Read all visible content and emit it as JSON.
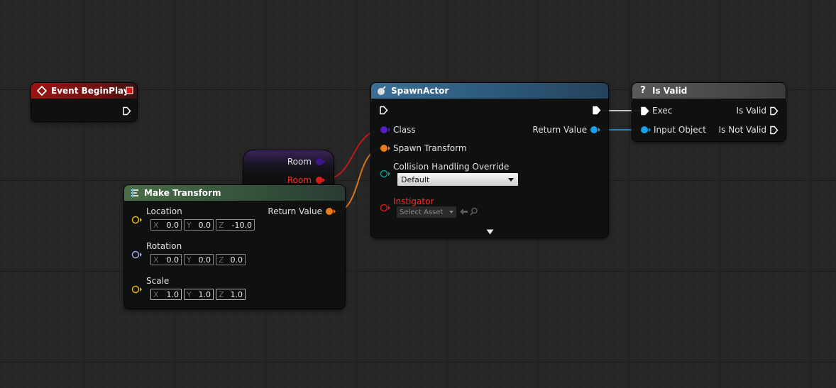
{
  "colors": {
    "exec": "#ffffff",
    "class_pin": "#5a1ac8",
    "transform_pin": "#f07a14",
    "object_pin": "#1aa0e8",
    "enum_pin": "#0a7a6e",
    "instigator_pin": "#d41a1a",
    "room_pin": "#e01a1a",
    "vector_pin": "#e8b400",
    "rotator_pin": "#9aa8e8",
    "instigator_text": "#ff2a2a",
    "room_text": "#ff2a2a",
    "event_header": "#8a1313",
    "spawn_header": "#2e5e7e",
    "make_header": "#3b5d3a",
    "isvalid_header": "#4a4a4a",
    "room_header": "#4a2a70"
  },
  "nodes": {
    "event_begin_play": {
      "title": "Event BeginPlay",
      "header_icon": "event-diamond-icon",
      "corner_icon": "delegate-square-icon"
    },
    "spawn_actor": {
      "title": "SpawnActor",
      "header_icon": "spawn-actor-icon",
      "pins": {
        "class": "Class",
        "spawn_transform": "Spawn Transform",
        "collision": "Collision Handling Override",
        "return_value": "Return Value",
        "instigator": "Instigator"
      },
      "collision_value": "Default",
      "instigator_placeholder": "Select Asset",
      "expand_icon": "chevron-down-icon"
    },
    "is_valid": {
      "title": "Is Valid",
      "header_icon": "question-mark-icon",
      "pins": {
        "exec": "Exec",
        "input_object": "Input Object",
        "is_valid": "Is Valid",
        "is_not_valid": "Is Not Valid"
      }
    },
    "room_getter": {
      "input_label": "Room",
      "output_label": "Room"
    },
    "make_transform": {
      "title": "Make Transform",
      "header_icon": "function-icon",
      "return_value": "Return Value",
      "location": {
        "label": "Location",
        "x": "0.0",
        "y": "0.0",
        "z": "-10.0"
      },
      "rotation": {
        "label": "Rotation",
        "x": "0.0",
        "y": "0.0",
        "z": "0.0"
      },
      "scale": {
        "label": "Scale",
        "x": "1.0",
        "y": "1.0",
        "z": "1.0"
      }
    }
  },
  "axis_labels": {
    "x": "X",
    "y": "Y",
    "z": "Z"
  }
}
